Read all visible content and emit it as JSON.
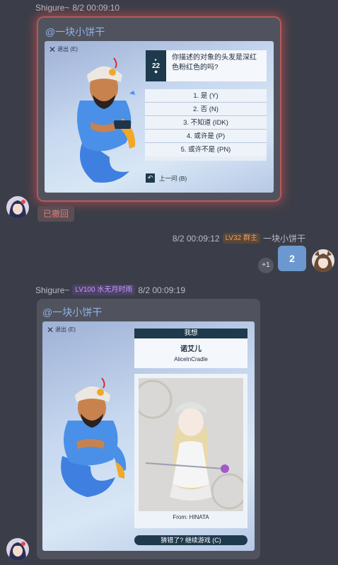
{
  "msg1": {
    "sender": "Shigure~",
    "time": "8/2 00:09:10",
    "mention": "@一块小饼干",
    "game": {
      "exit_label": "退出 (E)",
      "question_number": "22",
      "question_text": "你描述的对象的头发是深红色粉红色的吗?",
      "answers": [
        "1. 是 (Y)",
        "2. 否 (N)",
        "3. 不知道 (IDK)",
        "4. 或许是 (P)",
        "5. 或许不是 (PN)"
      ],
      "back_label": "上一问 (B)"
    },
    "withdrawn_label": "已撤回"
  },
  "msg2": {
    "time": "8/2 00:09:12",
    "level_badge": "LV32 群主",
    "sender": "一块小饼干",
    "content": "2",
    "reaction": "+1"
  },
  "msg3": {
    "sender": "Shigure~",
    "level_badge": "LV100 水无月时雨",
    "time": "8/2 00:09:19",
    "mention": "@一块小饼干",
    "game": {
      "exit_label": "退出 (E)",
      "think_label": "我想",
      "guess_name": "诺艾儿",
      "guess_sub": "AliceInCradle",
      "from_label": "From: HINATA",
      "continue_label": "猜错了? 继续游戏 (C)"
    }
  },
  "colors": {
    "background": "#3b3e48",
    "bubble": "#50535e",
    "mention": "#8fb2ea",
    "accent_dark": "#1e3a4c",
    "number_bubble": "#6c98cf"
  }
}
